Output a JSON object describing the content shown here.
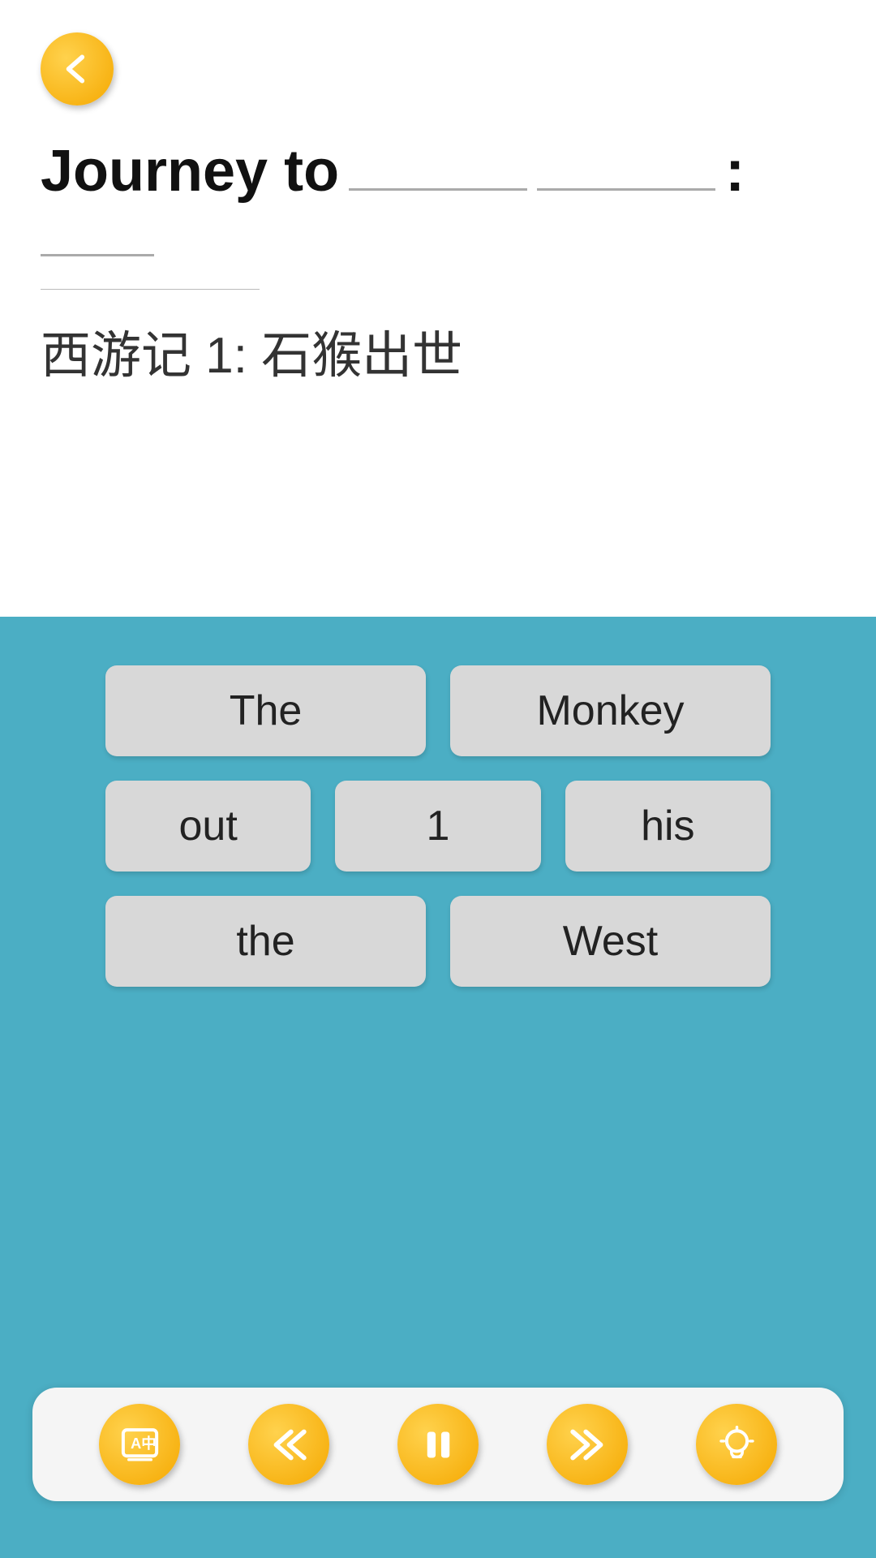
{
  "header": {
    "back_button_label": "back"
  },
  "title": {
    "prefix": "Journey to",
    "blank1": "",
    "blank2": "",
    "colon": ":",
    "blank3": ""
  },
  "subtitle": {
    "chinese": "西游记 1: 石猴出世"
  },
  "word_tiles": {
    "row1": [
      {
        "id": "tile-the",
        "label": "The"
      },
      {
        "id": "tile-monkey",
        "label": "Monkey"
      }
    ],
    "row2": [
      {
        "id": "tile-out",
        "label": "out"
      },
      {
        "id": "tile-1",
        "label": "1"
      },
      {
        "id": "tile-his",
        "label": "his"
      }
    ],
    "row3": [
      {
        "id": "tile-the2",
        "label": "the"
      },
      {
        "id": "tile-west",
        "label": "West"
      }
    ]
  },
  "toolbar": {
    "flashcard_label": "flashcard",
    "rewind_label": "rewind",
    "pause_label": "pause",
    "forward_label": "forward",
    "hint_label": "hint"
  }
}
